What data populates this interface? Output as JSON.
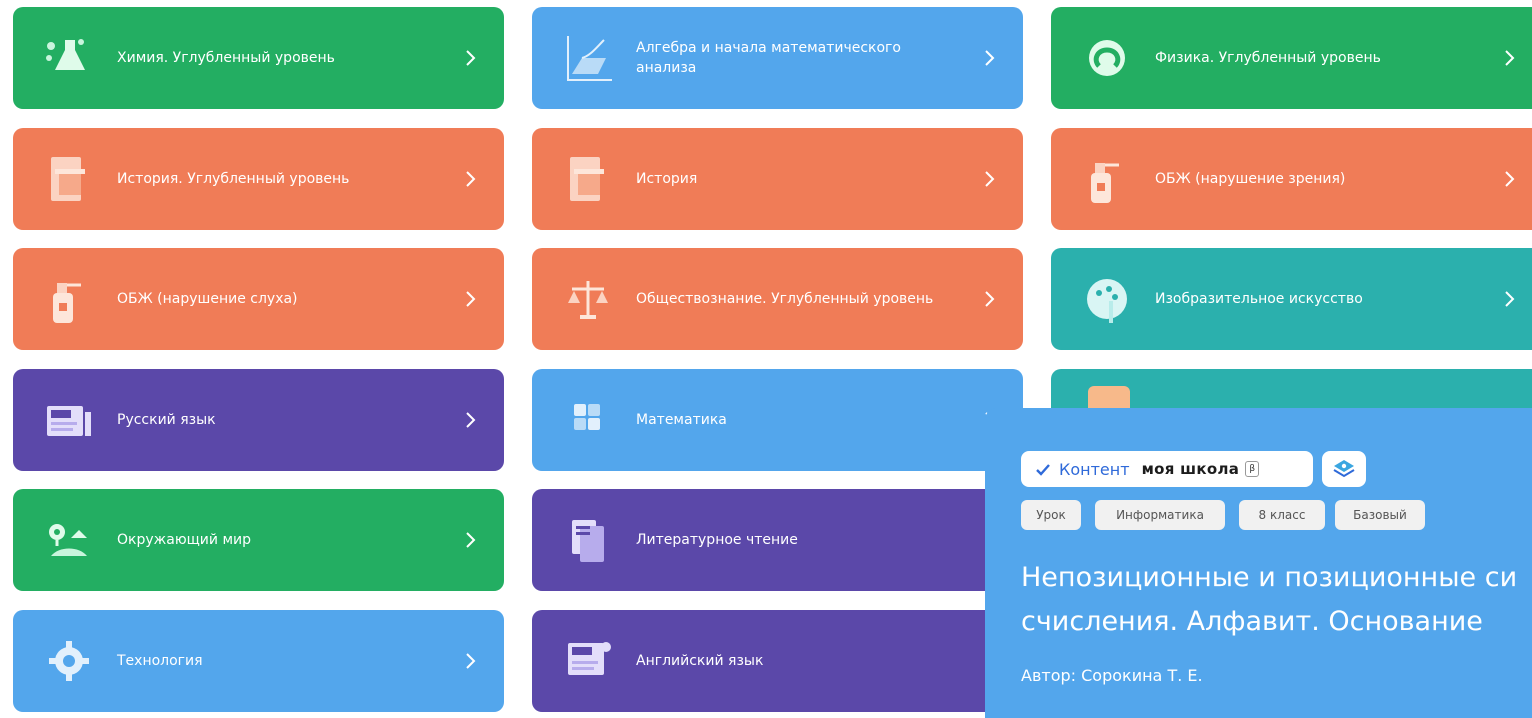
{
  "subjects": [
    {
      "label": "Химия. Углубленный уровень",
      "color": "#23ae62",
      "icon": "chemistry-flask-icon"
    },
    {
      "label": "Алгебра и начала математического анализа",
      "color": "#53a6ec",
      "icon": "graph-icon"
    },
    {
      "label": "Физика. Углубленный уровень",
      "color": "#23ae62",
      "icon": "magnet-icon"
    },
    {
      "label": "История. Углубленный уровень",
      "color": "#f07c57",
      "icon": "book-column-icon"
    },
    {
      "label": "История",
      "color": "#f07c57",
      "icon": "book-column-icon"
    },
    {
      "label": "ОБЖ (нарушение зрения)",
      "color": "#f07c57",
      "icon": "fire-extinguisher-icon"
    },
    {
      "label": "ОБЖ (нарушение слуха)",
      "color": "#f07c57",
      "icon": "fire-extinguisher-icon"
    },
    {
      "label": "Обществознание. Углубленный уровень",
      "color": "#f07c57",
      "icon": "scales-icon"
    },
    {
      "label": "Изобразительное искусство",
      "color": "#2bb0ad",
      "icon": "palette-icon"
    },
    {
      "label": "Русский язык",
      "color": "#5b48a9",
      "icon": "russian-alphabet-icon"
    },
    {
      "label": "Математика",
      "color": "#53a6ec",
      "icon": "math-blocks-icon"
    },
    {
      "label": "Окружающий мир",
      "color": "#23ae62",
      "icon": "nature-icon"
    },
    {
      "label": "Литературное чтение",
      "color": "#5b48a9",
      "icon": "books-icon"
    },
    {
      "label": "Технология",
      "color": "#53a6ec",
      "icon": "gear-icon"
    },
    {
      "label": "Английский язык",
      "color": "#5b48a9",
      "icon": "english-alphabet-icon"
    }
  ],
  "lesson": {
    "brand_check": "✓",
    "brand_kontent": "Контент",
    "brand_school": "моя школа",
    "brand_beta": "β",
    "tags": [
      "Урок",
      "Информатика",
      "8 класс",
      "Базовый"
    ],
    "title_line1": "Непозиционные и позиционные си",
    "title_line2": "счисления. Алфавит. Основание",
    "author": "Автор: Сорокина Т. Е."
  }
}
